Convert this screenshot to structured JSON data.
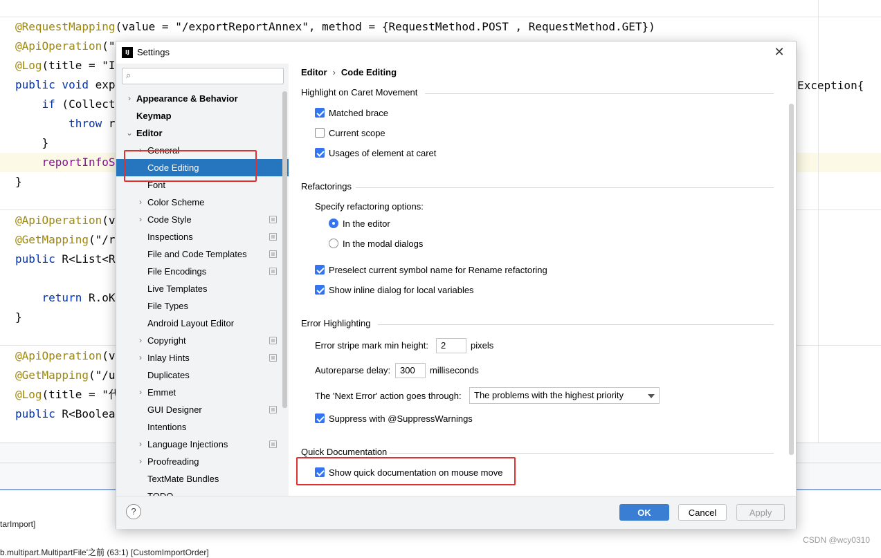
{
  "editor": {
    "lines": [
      {
        "ann": "@RequestMapping",
        "rest": "(value = \"/exportReportAnnex\", method = {RequestMethod.POST , RequestMethod.GET})"
      },
      {
        "ann": "@ApiOperation",
        "rest": "(\""
      },
      {
        "ann": "@Log",
        "rest": "(title = \"I"
      },
      {
        "kw": "public void",
        "rest": " exp"
      },
      {
        "kw": "    if",
        "rest": " (Collect"
      },
      {
        "kw": "        throw",
        "rest": " r"
      },
      {
        "plain": "    }"
      },
      {
        "purple": "    reportInfoS"
      },
      {
        "plain": "}"
      },
      {
        "ann": "@ApiOperation",
        "rest": "(v"
      },
      {
        "ann": "@GetMapping",
        "rest": "(\"/r"
      },
      {
        "kw": "public",
        "rest": " R<List<R"
      },
      {
        "kw": "    return",
        "rest": " R.oK"
      },
      {
        "plain": "}"
      },
      {
        "ann": "@ApiOperation",
        "rest": "(v"
      },
      {
        "ann": "@GetMapping",
        "rest": "(\"/u"
      },
      {
        "ann": "@Log",
        "rest": "(title = \"代"
      },
      {
        "kw": "public",
        "rest": " R<Boolea"
      }
    ],
    "right_exception": "Exception{",
    "bottom_line1": "tarImport]",
    "bottom_line2": "b.multipart.MultipartFile'之前     (63:1) [CustomImportOrder]",
    "watermark": "CSDN @wcy0310"
  },
  "dialog": {
    "title": "Settings",
    "close_glyph": "✕",
    "app_icon_text": "IJ",
    "search_placeholder": "",
    "search_glyph": "⌕",
    "breadcrumb": {
      "parent": "Editor",
      "separator": "›",
      "current": "Code Editing"
    },
    "tree": [
      {
        "label": "Appearance & Behavior",
        "level": 0,
        "arrow": "›",
        "bold": true
      },
      {
        "label": "Keymap",
        "level": 0,
        "arrow": "",
        "bold": true
      },
      {
        "label": "Editor",
        "level": 0,
        "arrow": "⌄",
        "bold": true
      },
      {
        "label": "General",
        "level": 1,
        "arrow": "›"
      },
      {
        "label": "Code Editing",
        "level": 1,
        "arrow": "",
        "selected": true
      },
      {
        "label": "Font",
        "level": 1,
        "arrow": ""
      },
      {
        "label": "Color Scheme",
        "level": 1,
        "arrow": "›"
      },
      {
        "label": "Code Style",
        "level": 1,
        "arrow": "›",
        "badge": true
      },
      {
        "label": "Inspections",
        "level": 1,
        "arrow": "",
        "badge": true
      },
      {
        "label": "File and Code Templates",
        "level": 1,
        "arrow": "",
        "badge": true
      },
      {
        "label": "File Encodings",
        "level": 1,
        "arrow": "",
        "badge": true
      },
      {
        "label": "Live Templates",
        "level": 1,
        "arrow": ""
      },
      {
        "label": "File Types",
        "level": 1,
        "arrow": ""
      },
      {
        "label": "Android Layout Editor",
        "level": 1,
        "arrow": ""
      },
      {
        "label": "Copyright",
        "level": 1,
        "arrow": "›",
        "badge": true
      },
      {
        "label": "Inlay Hints",
        "level": 1,
        "arrow": "›",
        "badge": true
      },
      {
        "label": "Duplicates",
        "level": 1,
        "arrow": ""
      },
      {
        "label": "Emmet",
        "level": 1,
        "arrow": "›"
      },
      {
        "label": "GUI Designer",
        "level": 1,
        "arrow": "",
        "badge": true
      },
      {
        "label": "Intentions",
        "level": 1,
        "arrow": ""
      },
      {
        "label": "Language Injections",
        "level": 1,
        "arrow": "›",
        "badge": true
      },
      {
        "label": "Proofreading",
        "level": 1,
        "arrow": "›"
      },
      {
        "label": "TextMate Bundles",
        "level": 1,
        "arrow": ""
      },
      {
        "label": "TODO",
        "level": 1,
        "arrow": ""
      }
    ],
    "sections": {
      "caret": {
        "title": "Highlight on Caret Movement",
        "options": [
          {
            "label": "Matched brace",
            "checked": true
          },
          {
            "label": "Current scope",
            "checked": false
          },
          {
            "label": "Usages of element at caret",
            "checked": true
          }
        ]
      },
      "refactorings": {
        "title": "Refactorings",
        "specify_label": "Specify refactoring options:",
        "radios": [
          {
            "label": "In the editor",
            "selected": true
          },
          {
            "label": "In the modal dialogs",
            "selected": false
          }
        ],
        "options": [
          {
            "label": "Preselect current symbol name for Rename refactoring",
            "checked": true
          },
          {
            "label": "Show inline dialog for local variables",
            "checked": true
          }
        ]
      },
      "errors": {
        "title": "Error Highlighting",
        "stripe_label": "Error stripe mark min height:",
        "stripe_value": "2",
        "stripe_unit": "pixels",
        "reparse_label": "Autoreparse delay:",
        "reparse_value": "300",
        "reparse_unit": "milliseconds",
        "next_error_label": "The 'Next Error' action goes through:",
        "next_error_value": "The problems with the highest priority",
        "suppress_label": "Suppress with @SuppressWarnings",
        "suppress_checked": true
      },
      "quickdoc": {
        "title": "Quick Documentation",
        "option_label": "Show quick documentation on mouse move",
        "checked": true
      }
    },
    "footer": {
      "help": "?",
      "ok": "OK",
      "cancel": "Cancel",
      "apply": "Apply"
    }
  },
  "colors": {
    "selection": "#2675bf",
    "accent": "#3574f0",
    "highlight_box": "#e03131"
  }
}
